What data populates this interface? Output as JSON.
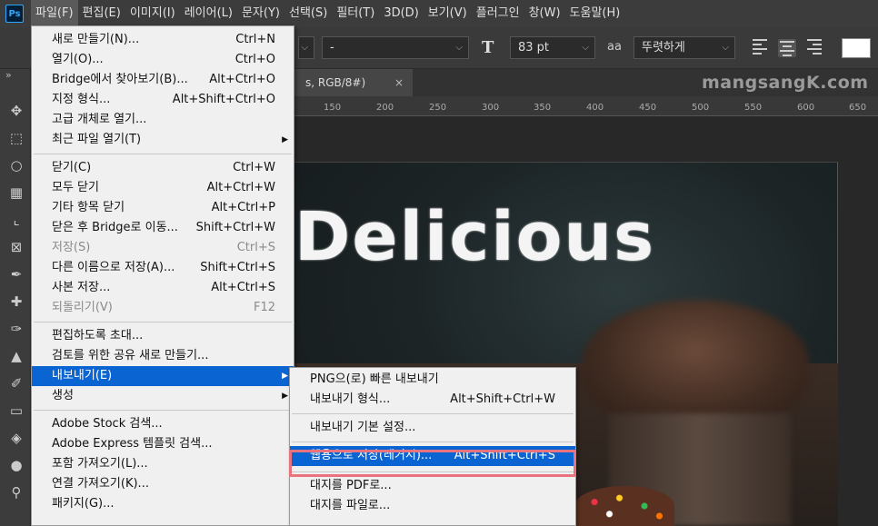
{
  "menubar": {
    "logo": "Ps",
    "items": [
      "파일(F)",
      "편집(E)",
      "이미지(I)",
      "레이어(L)",
      "문자(Y)",
      "선택(S)",
      "필터(T)",
      "3D(D)",
      "보기(V)",
      "플러그인",
      "창(W)",
      "도움말(H)"
    ]
  },
  "options": {
    "font_style": "-",
    "size": "83 pt",
    "antialias_icon": "aa",
    "antialias": "뚜렷하게",
    "colors": {
      "swatch": "#ffffff"
    }
  },
  "document": {
    "tab_label": "s, RGB/8#)",
    "close": "×",
    "watermark": "mangsangK.com",
    "headline": "Delicious"
  },
  "ruler": [
    "150",
    "200",
    "250",
    "300",
    "350",
    "400",
    "450",
    "500",
    "550",
    "600",
    "650"
  ],
  "file_menu": {
    "groups": [
      [
        {
          "label": "새로 만들기(N)...",
          "shortcut": "Ctrl+N"
        },
        {
          "label": "열기(O)...",
          "shortcut": "Ctrl+O"
        },
        {
          "label": "Bridge에서 찾아보기(B)...",
          "shortcut": "Alt+Ctrl+O"
        },
        {
          "label": "지정 형식...",
          "shortcut": "Alt+Shift+Ctrl+O"
        },
        {
          "label": "고급 개체로 열기...",
          "shortcut": ""
        },
        {
          "label": "최근 파일 열기(T)",
          "shortcut": "",
          "submenu": true
        }
      ],
      [
        {
          "label": "닫기(C)",
          "shortcut": "Ctrl+W"
        },
        {
          "label": "모두 닫기",
          "shortcut": "Alt+Ctrl+W"
        },
        {
          "label": "기타 항목 닫기",
          "shortcut": "Alt+Ctrl+P"
        },
        {
          "label": "닫은 후 Bridge로 이동...",
          "shortcut": "Shift+Ctrl+W"
        },
        {
          "label": "저장(S)",
          "shortcut": "Ctrl+S",
          "disabled": true
        },
        {
          "label": "다른 이름으로 저장(A)...",
          "shortcut": "Shift+Ctrl+S"
        },
        {
          "label": "사본 저장...",
          "shortcut": "Alt+Ctrl+S"
        },
        {
          "label": "되돌리기(V)",
          "shortcut": "F12",
          "disabled": true
        }
      ],
      [
        {
          "label": "편집하도록 초대...",
          "shortcut": ""
        },
        {
          "label": "검토를 위한 공유 새로 만들기...",
          "shortcut": ""
        },
        {
          "label": "내보내기(E)",
          "shortcut": "",
          "submenu": true,
          "highlighted": true
        },
        {
          "label": "생성",
          "shortcut": "",
          "submenu": true
        }
      ],
      [
        {
          "label": "Adobe Stock 검색...",
          "shortcut": ""
        },
        {
          "label": "Adobe Express 템플릿 검색...",
          "shortcut": ""
        },
        {
          "label": "포함 가져오기(L)...",
          "shortcut": ""
        },
        {
          "label": "연결 가져오기(K)...",
          "shortcut": ""
        },
        {
          "label": "패키지(G)...",
          "shortcut": ""
        }
      ]
    ]
  },
  "export_menu": {
    "items": [
      {
        "label": "PNG으(로) 빠른 내보내기",
        "shortcut": ""
      },
      {
        "label": "내보내기 형식...",
        "shortcut": "Alt+Shift+Ctrl+W"
      },
      {
        "sep": true
      },
      {
        "label": "내보내기 기본 설정...",
        "shortcut": ""
      },
      {
        "sep": true
      },
      {
        "label": "웹용으로 저장(레거시)...",
        "shortcut": "Alt+Shift+Ctrl+S",
        "highlighted": true
      },
      {
        "sep": true
      },
      {
        "label": "대지를 PDF로...",
        "shortcut": ""
      },
      {
        "label": "대지를 파일로...",
        "shortcut": ""
      }
    ]
  },
  "tools": [
    "move-icon",
    "marquee-icon",
    "lasso-icon",
    "quick-select-icon",
    "crop-icon",
    "frame-icon",
    "eyedropper-icon",
    "healing-icon",
    "brush-icon",
    "stamp-icon",
    "history-brush-icon",
    "eraser-icon",
    "paint-bucket-icon",
    "blur-icon",
    "dodge-icon"
  ]
}
